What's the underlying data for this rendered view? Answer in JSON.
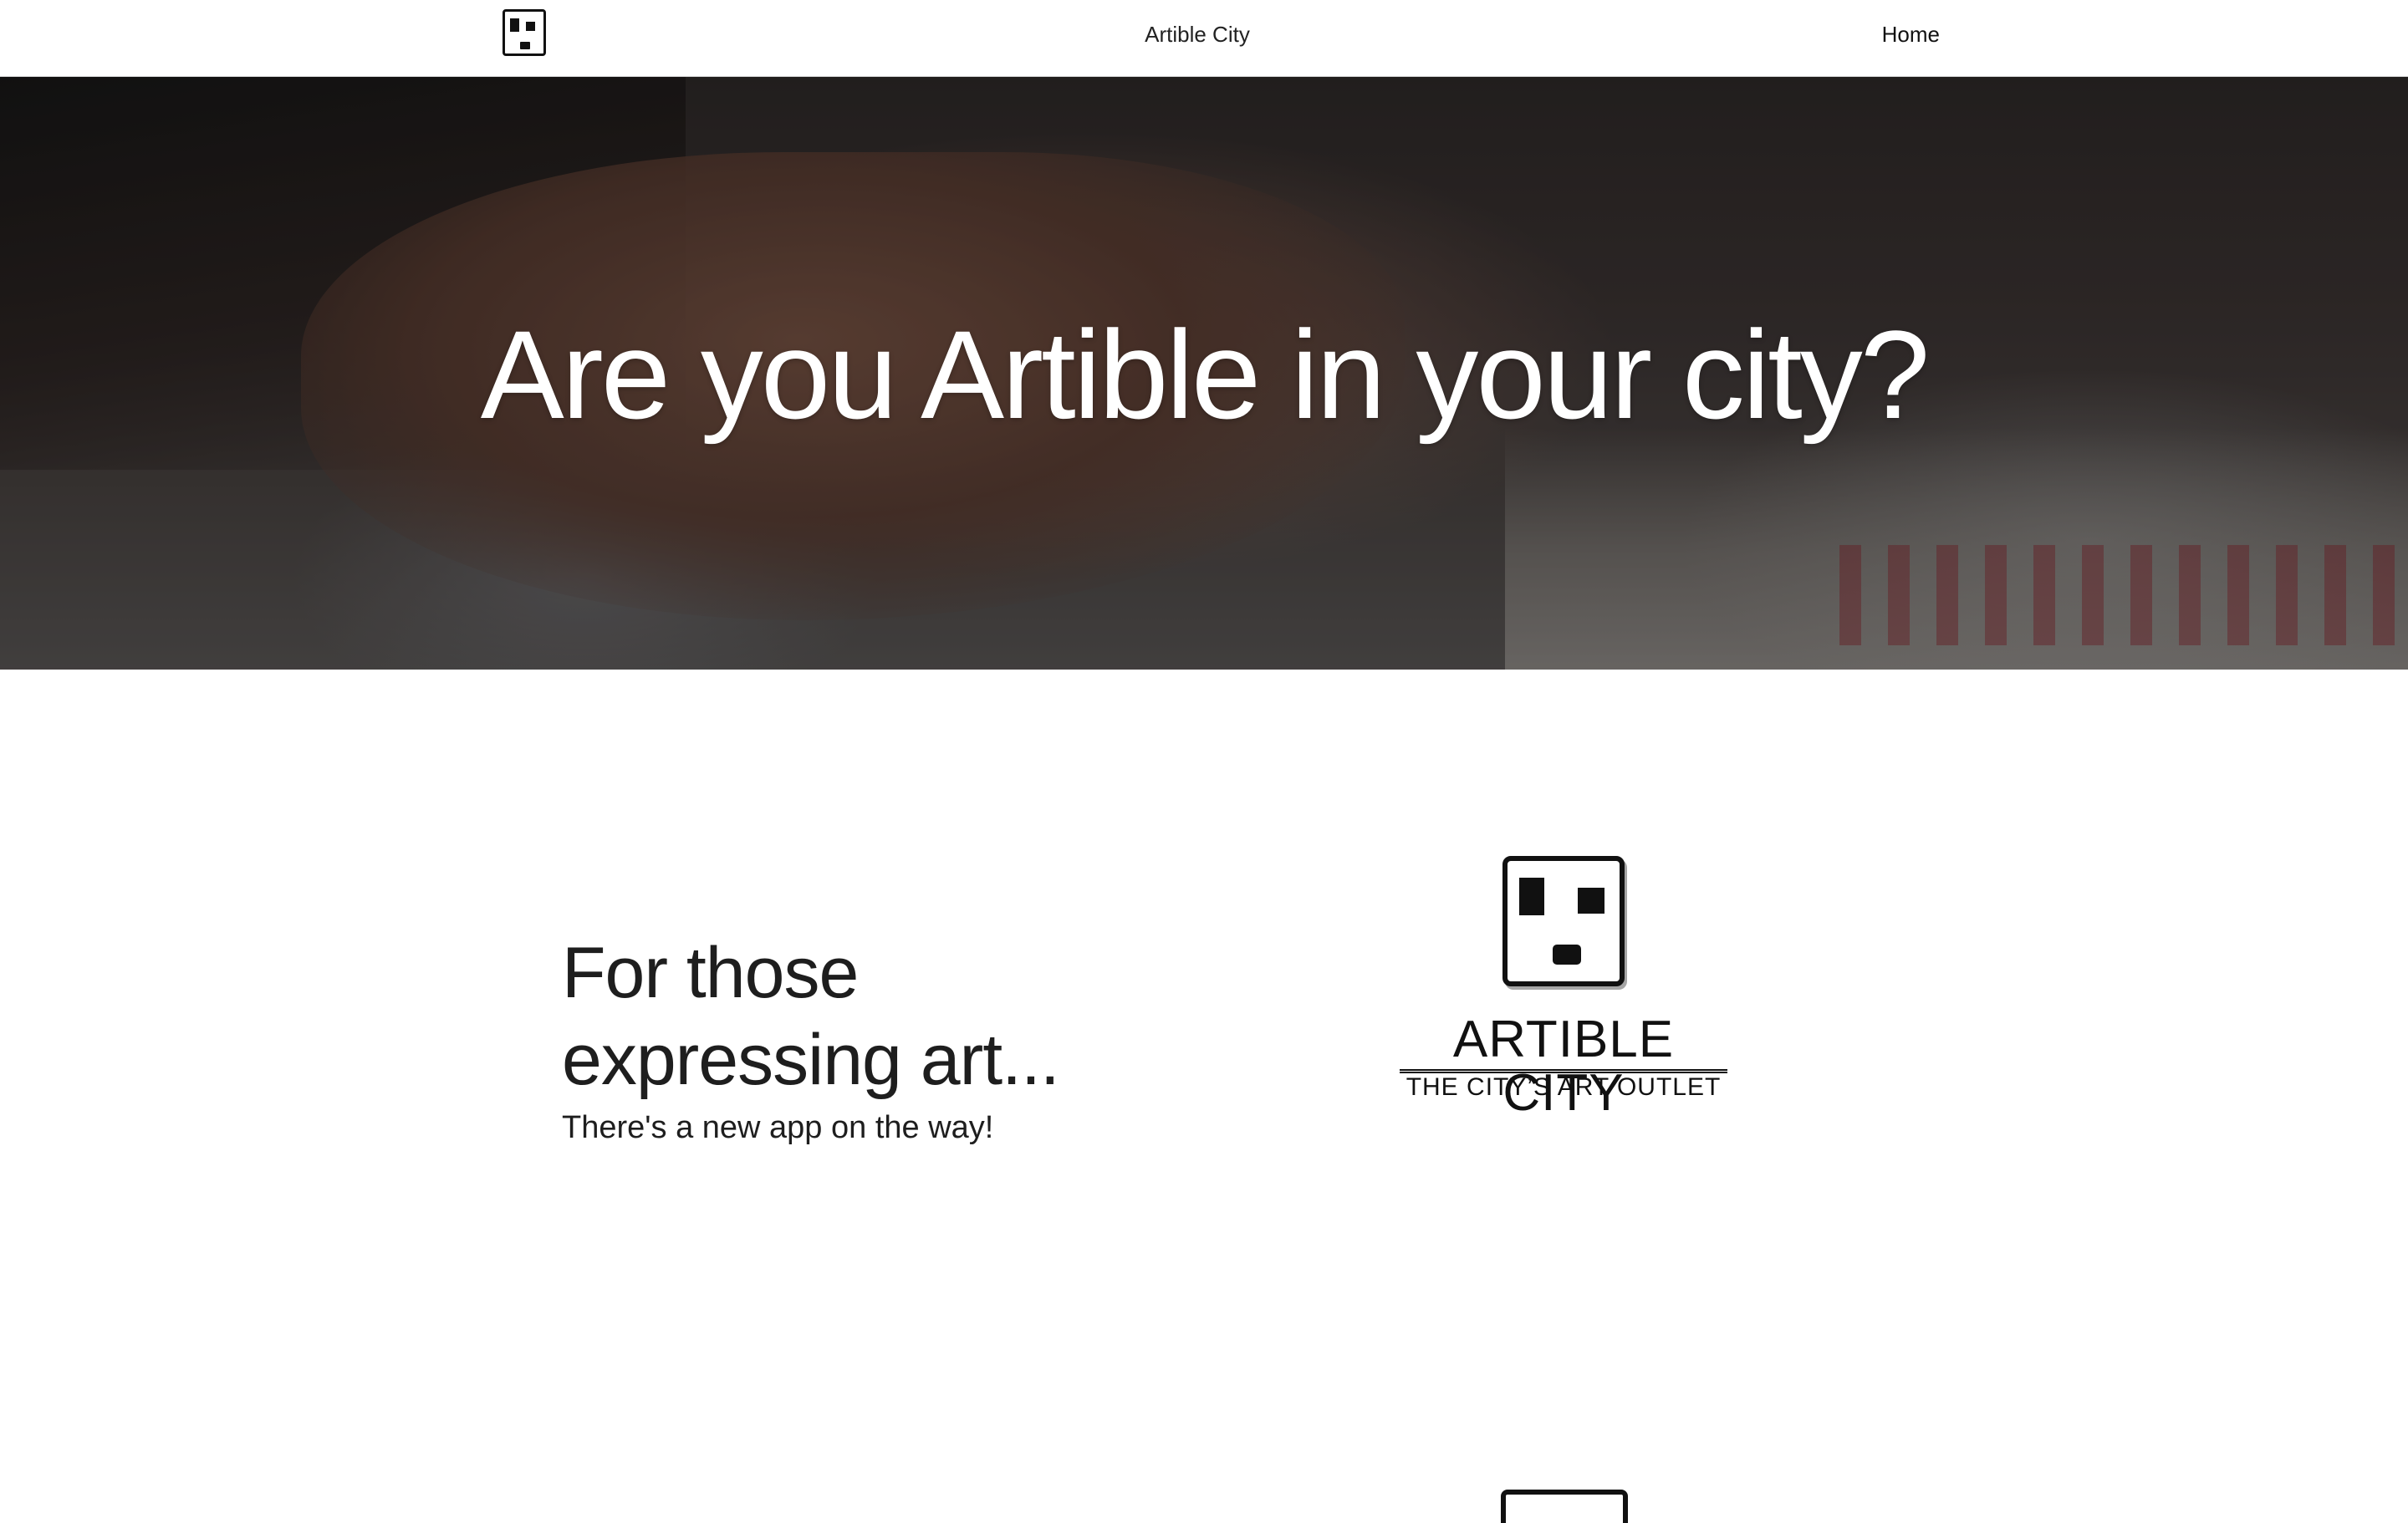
{
  "nav": {
    "title": "Artible City",
    "home_label": "Home",
    "logo_icon": "artible-face-logo-icon"
  },
  "hero": {
    "heading": "Are you Artible in your city?"
  },
  "intro": {
    "heading": "For those expressing art...",
    "subheading": "There's a new app on the way!"
  },
  "brand": {
    "name": "ARTIBLE CITY",
    "tagline": "THE CITY’S ART OUTLET",
    "logo_icon": "artible-face-logo-icon"
  },
  "colors": {
    "text": "#1e1e1e",
    "nav_background": "#ffffff",
    "hero_text": "#ffffff"
  }
}
